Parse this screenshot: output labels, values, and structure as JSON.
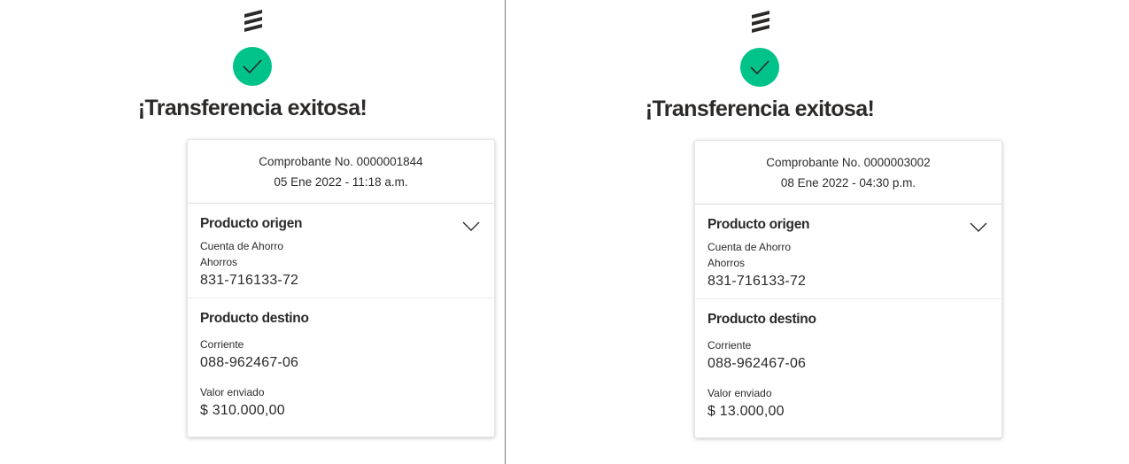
{
  "colors": {
    "success": "#00c389",
    "text": "#2c2a29"
  },
  "receipts": [
    {
      "title": "¡Transferencia exitosa!",
      "receipt": "Comprobante No. 0000001844",
      "datetime": "05 Ene 2022 - 11:18 a.m.",
      "origin": {
        "heading": "Producto origen",
        "account_type": "Cuenta de Ahorro",
        "account_subtype": "Ahorros",
        "account_number": "831-716133-72"
      },
      "destination": {
        "heading": "Producto destino",
        "account_type": "Corriente",
        "account_number": "088-962467-06"
      },
      "amount": {
        "label": "Valor enviado",
        "value": "$ 310.000,00"
      }
    },
    {
      "title": "¡Transferencia exitosa!",
      "receipt": "Comprobante No. 0000003002",
      "datetime": "08 Ene 2022 - 04:30 p.m.",
      "origin": {
        "heading": "Producto origen",
        "account_type": "Cuenta de Ahorro",
        "account_subtype": "Ahorros",
        "account_number": "831-716133-72"
      },
      "destination": {
        "heading": "Producto destino",
        "account_type": "Corriente",
        "account_number": "088-962467-06"
      },
      "amount": {
        "label": "Valor enviado",
        "value": "$ 13.000,00"
      }
    }
  ],
  "icons": {
    "logo": "bank-logo-icon",
    "success": "check-icon",
    "expand": "chevron-down-icon"
  }
}
